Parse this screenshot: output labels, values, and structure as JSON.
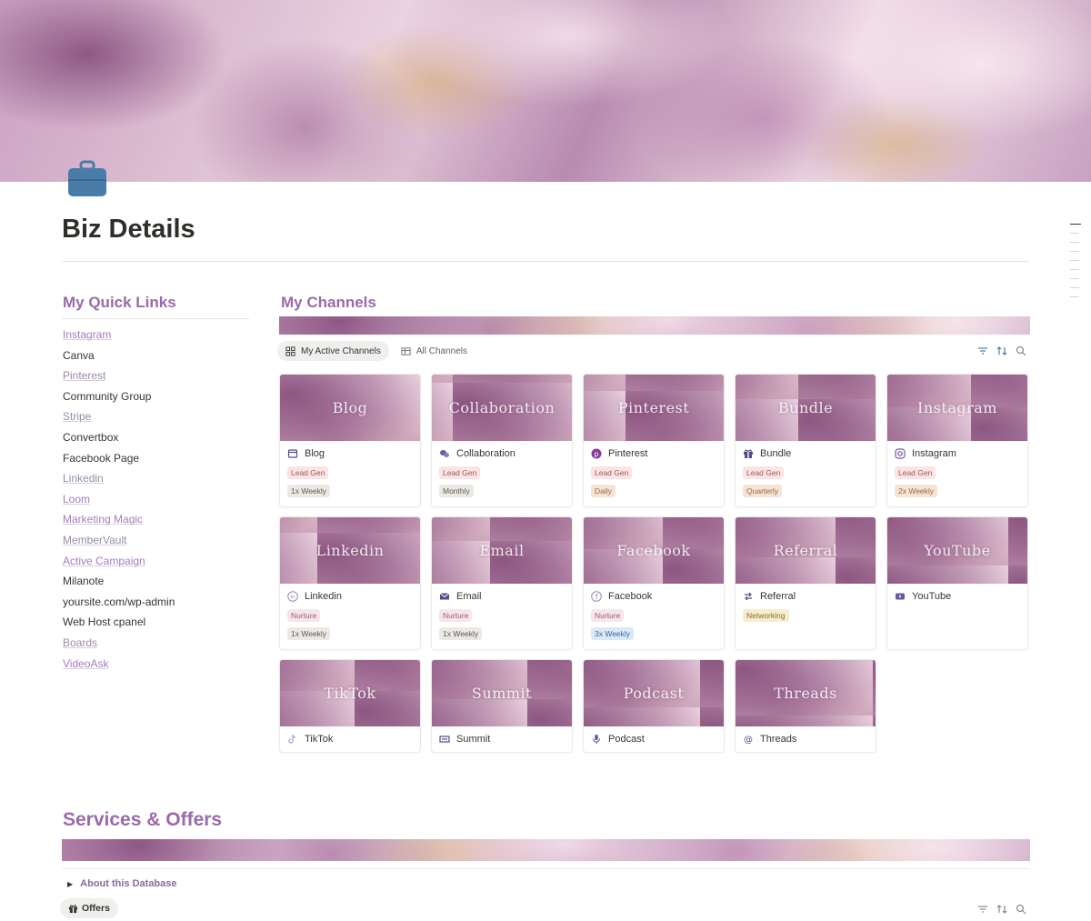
{
  "page": {
    "title": "Biz Details",
    "icon": "briefcase-icon"
  },
  "colors": {
    "accent_purple": "#9a6aaa",
    "icon_blue": "#4a7ca8"
  },
  "quick_links": {
    "heading": "My Quick Links",
    "items": [
      {
        "label": "Instagram",
        "link": true,
        "purple": true
      },
      {
        "label": "Canva",
        "link": false
      },
      {
        "label": "Pinterest",
        "link": true
      },
      {
        "label": "Community Group",
        "link": false
      },
      {
        "label": "Stripe",
        "link": true
      },
      {
        "label": "Convertbox",
        "link": false
      },
      {
        "label": "Facebook Page",
        "link": false
      },
      {
        "label": "Linkedin",
        "link": true
      },
      {
        "label": "Loom",
        "link": true,
        "purple": true
      },
      {
        "label": "Marketing Magic",
        "link": true,
        "purple": true
      },
      {
        "label": "MemberVault",
        "link": true
      },
      {
        "label": "Active Campaign",
        "link": true,
        "purple": true
      },
      {
        "label": "Milanote",
        "link": false
      },
      {
        "label": "yoursite.com/wp-admin",
        "link": false
      },
      {
        "label": "Web Host cpanel",
        "link": false
      },
      {
        "label": "Boards",
        "link": true
      },
      {
        "label": "VideoAsk",
        "link": true,
        "purple": true
      }
    ]
  },
  "channels": {
    "heading": "My Channels",
    "views": [
      {
        "label": "My Active Channels",
        "icon": "gallery-icon",
        "active": true
      },
      {
        "label": "All Channels",
        "icon": "table-icon",
        "active": false
      }
    ],
    "cards": [
      {
        "title": "Blog",
        "name": "Blog",
        "icon": "blog-icon",
        "tags": [
          {
            "text": "Lead Gen",
            "kind": "lead"
          },
          {
            "text": "1x Weekly",
            "kind": "freq"
          }
        ]
      },
      {
        "title": "Collaboration",
        "name": "Collaboration",
        "icon": "chat-icon",
        "tags": [
          {
            "text": "Lead Gen",
            "kind": "lead"
          },
          {
            "text": "Monthly",
            "kind": "freq"
          }
        ]
      },
      {
        "title": "Pinterest",
        "name": "Pinterest",
        "icon": "pinterest-icon",
        "tags": [
          {
            "text": "Lead Gen",
            "kind": "lead"
          },
          {
            "text": "Daily",
            "kind": "daily"
          }
        ]
      },
      {
        "title": "Bundle",
        "name": "Bundle",
        "icon": "gift-icon",
        "tags": [
          {
            "text": "Lead Gen",
            "kind": "lead"
          },
          {
            "text": "Quarterly",
            "kind": "daily"
          }
        ]
      },
      {
        "title": "Instagram",
        "name": "Instagram",
        "icon": "instagram-icon",
        "tags": [
          {
            "text": "Lead Gen",
            "kind": "lead"
          },
          {
            "text": "2x Weekly",
            "kind": "daily"
          }
        ]
      },
      {
        "title": "Linkedin",
        "name": "Linkedin",
        "icon": "linkedin-icon",
        "tags": [
          {
            "text": "Nurture",
            "kind": "nurture"
          },
          {
            "text": "1x Weekly",
            "kind": "freq"
          }
        ]
      },
      {
        "title": "Email",
        "name": "Email",
        "icon": "email-icon",
        "tags": [
          {
            "text": "Nurture",
            "kind": "nurture"
          },
          {
            "text": "1x Weekly",
            "kind": "freq"
          }
        ]
      },
      {
        "title": "Facebook",
        "name": "Facebook",
        "icon": "facebook-icon",
        "tags": [
          {
            "text": "Nurture",
            "kind": "nurture"
          },
          {
            "text": "3x Weekly",
            "kind": "blue"
          }
        ]
      },
      {
        "title": "Referral",
        "name": "Referral",
        "icon": "referral-icon",
        "tags": [
          {
            "text": "Networking",
            "kind": "net"
          }
        ]
      },
      {
        "title": "YouTube",
        "name": "YouTube",
        "icon": "youtube-icon",
        "tags": []
      },
      {
        "title": "TikTok",
        "name": "TikTok",
        "icon": "tiktok-icon",
        "tags": []
      },
      {
        "title": "Summit",
        "name": "Summit",
        "icon": "summit-icon",
        "tags": []
      },
      {
        "title": "Podcast",
        "name": "Podcast",
        "icon": "microphone-icon",
        "tags": []
      },
      {
        "title": "Threads",
        "name": "Threads",
        "icon": "threads-icon",
        "tags": []
      }
    ]
  },
  "services": {
    "heading": "Services & Offers",
    "about_label": "About this Database",
    "offers_tab": "Offers"
  }
}
